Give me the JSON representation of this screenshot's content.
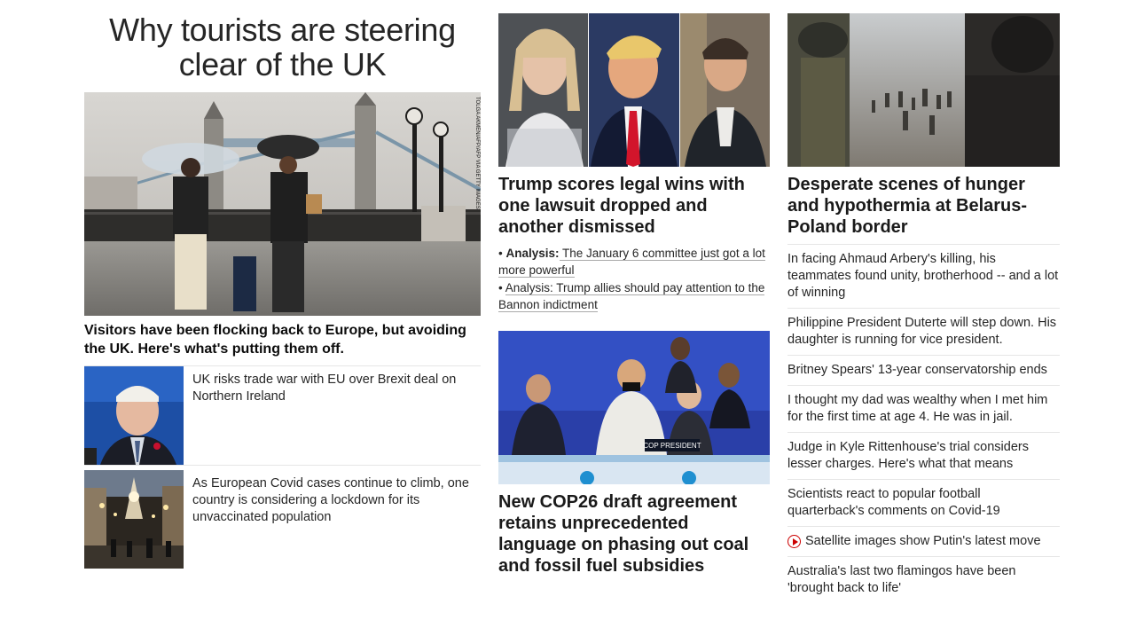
{
  "hero": {
    "title": "Why tourists are steering clear of the UK",
    "photo_credit": "TOLGA AKMEN/AFP/AFP VIA GETTY IMAGES",
    "subheadline": "Visitors have been flocking back to Europe, but avoiding the UK. Here's what's putting them off."
  },
  "side_stories": [
    {
      "text": "UK risks trade war with EU over Brexit deal on Northern Ireland"
    },
    {
      "text": "As European Covid cases continue to climb, one country is considering a lockdown for its unvaccinated population"
    }
  ],
  "trump_story": {
    "title": "Trump scores legal wins with one lawsuit dropped and another dismissed",
    "bullets": [
      {
        "prefix": "Analysis:",
        "text": " The January 6 committee just got a lot more powerful"
      },
      {
        "prefix": "",
        "text": "Analysis: Trump allies should pay attention to the Bannon indictment"
      }
    ]
  },
  "cop_story": {
    "podium_label": "COP PRESIDENT",
    "title": "New COP26 draft agreement retains unprecedented language on phasing out coal and fossil fuel subsidies"
  },
  "belarus_story": {
    "title": "Desperate scenes of hunger and hypothermia at Belarus-Poland border"
  },
  "headlines": [
    {
      "text": "In facing Ahmaud Arbery's killing, his teammates found unity, brotherhood -- and a lot of winning",
      "video": false
    },
    {
      "text": "Philippine President Duterte will step down. His daughter is running for vice president.",
      "video": false
    },
    {
      "text": "Britney Spears' 13-year conservatorship ends",
      "video": false
    },
    {
      "text": "I thought my dad was wealthy when I met him for the first time at age 4. He was in jail.",
      "video": false
    },
    {
      "text": "Judge in Kyle Rittenhouse's trial considers lesser charges. Here's what that means",
      "video": false
    },
    {
      "text": "Scientists react to popular football quarterback's comments on Covid-19",
      "video": false
    },
    {
      "text": "Satellite images show Putin's latest move",
      "video": true
    },
    {
      "text": "Australia's last two flamingos have been 'brought back to life'",
      "video": false
    }
  ],
  "colors": {
    "video_icon": "#cc0000",
    "divider": "#e6e6e6"
  }
}
